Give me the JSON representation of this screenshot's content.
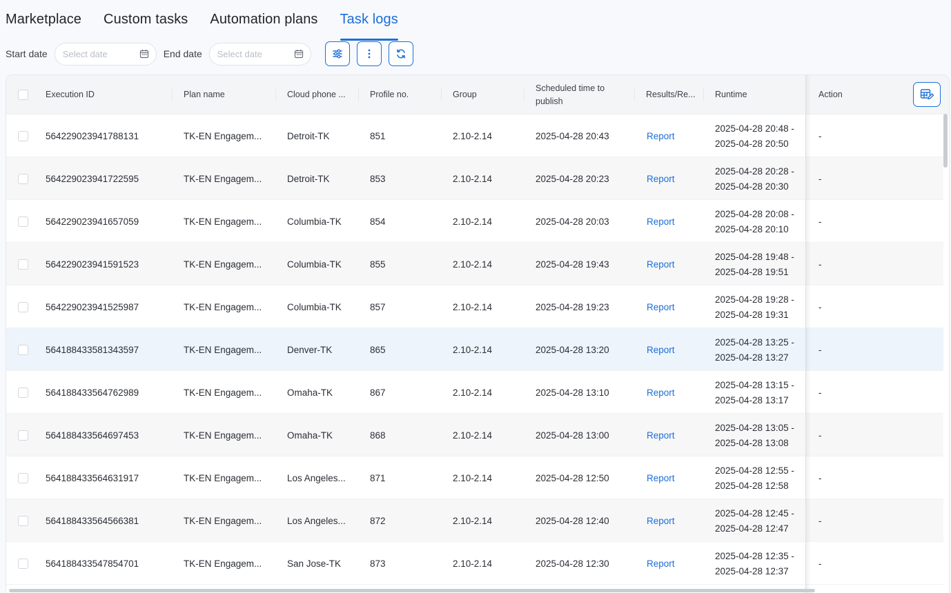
{
  "tabs": [
    {
      "label": "Marketplace",
      "active": false
    },
    {
      "label": "Custom tasks",
      "active": false
    },
    {
      "label": "Automation plans",
      "active": false
    },
    {
      "label": "Task logs",
      "active": true
    }
  ],
  "filters": {
    "start_label": "Start date",
    "start_placeholder": "Select date",
    "end_label": "End date",
    "end_placeholder": "Select date"
  },
  "columns": {
    "execution_id": "Execution ID",
    "plan_name": "Plan name",
    "cloud_phone": "Cloud phone ...",
    "profile_no": "Profile no.",
    "group": "Group",
    "scheduled": "Scheduled time to publish",
    "results": "Results/Re...",
    "runtime": "Runtime",
    "action": "Action"
  },
  "rows": [
    {
      "id": "564229023941788131",
      "plan": "TK-EN Engagem...",
      "phone": "Detroit-TK",
      "profile": "851",
      "group": "2.10-2.14",
      "scheduled": "2025-04-28 20:43",
      "result": "Report",
      "runtime_start": "2025-04-28 20:48 -",
      "runtime_end": "2025-04-28 20:50",
      "action": "-"
    },
    {
      "id": "564229023941722595",
      "plan": "TK-EN Engagem...",
      "phone": "Detroit-TK",
      "profile": "853",
      "group": "2.10-2.14",
      "scheduled": "2025-04-28 20:23",
      "result": "Report",
      "runtime_start": "2025-04-28 20:28 -",
      "runtime_end": "2025-04-28 20:30",
      "action": "-"
    },
    {
      "id": "564229023941657059",
      "plan": "TK-EN Engagem...",
      "phone": "Columbia-TK",
      "profile": "854",
      "group": "2.10-2.14",
      "scheduled": "2025-04-28 20:03",
      "result": "Report",
      "runtime_start": "2025-04-28 20:08 -",
      "runtime_end": "2025-04-28 20:10",
      "action": "-"
    },
    {
      "id": "564229023941591523",
      "plan": "TK-EN Engagem...",
      "phone": "Columbia-TK",
      "profile": "855",
      "group": "2.10-2.14",
      "scheduled": "2025-04-28 19:43",
      "result": "Report",
      "runtime_start": "2025-04-28 19:48 -",
      "runtime_end": "2025-04-28 19:51",
      "action": "-"
    },
    {
      "id": "564229023941525987",
      "plan": "TK-EN Engagem...",
      "phone": "Columbia-TK",
      "profile": "857",
      "group": "2.10-2.14",
      "scheduled": "2025-04-28 19:23",
      "result": "Report",
      "runtime_start": "2025-04-28 19:28 -",
      "runtime_end": "2025-04-28 19:31",
      "action": "-"
    },
    {
      "id": "564188433581343597",
      "plan": "TK-EN Engagem...",
      "phone": "Denver-TK",
      "profile": "865",
      "group": "2.10-2.14",
      "scheduled": "2025-04-28 13:20",
      "result": "Report",
      "runtime_start": "2025-04-28 13:25 -",
      "runtime_end": "2025-04-28 13:27",
      "action": "-"
    },
    {
      "id": "564188433564762989",
      "plan": "TK-EN Engagem...",
      "phone": "Omaha-TK",
      "profile": "867",
      "group": "2.10-2.14",
      "scheduled": "2025-04-28 13:10",
      "result": "Report",
      "runtime_start": "2025-04-28 13:15 -",
      "runtime_end": "2025-04-28 13:17",
      "action": "-"
    },
    {
      "id": "564188433564697453",
      "plan": "TK-EN Engagem...",
      "phone": "Omaha-TK",
      "profile": "868",
      "group": "2.10-2.14",
      "scheduled": "2025-04-28 13:00",
      "result": "Report",
      "runtime_start": "2025-04-28 13:05 -",
      "runtime_end": "2025-04-28 13:08",
      "action": "-"
    },
    {
      "id": "564188433564631917",
      "plan": "TK-EN Engagem...",
      "phone": "Los Angeles...",
      "profile": "871",
      "group": "2.10-2.14",
      "scheduled": "2025-04-28 12:50",
      "result": "Report",
      "runtime_start": "2025-04-28 12:55 -",
      "runtime_end": "2025-04-28 12:58",
      "action": "-"
    },
    {
      "id": "564188433564566381",
      "plan": "TK-EN Engagem...",
      "phone": "Los Angeles...",
      "profile": "872",
      "group": "2.10-2.14",
      "scheduled": "2025-04-28 12:40",
      "result": "Report",
      "runtime_start": "2025-04-28 12:45 -",
      "runtime_end": "2025-04-28 12:47",
      "action": "-"
    },
    {
      "id": "564188433547854701",
      "plan": "TK-EN Engagem...",
      "phone": "San Jose-TK",
      "profile": "873",
      "group": "2.10-2.14",
      "scheduled": "2025-04-28 12:30",
      "result": "Report",
      "runtime_start": "2025-04-28 12:35 -",
      "runtime_end": "2025-04-28 12:37",
      "action": "-"
    }
  ],
  "highlighted_row_index": 5,
  "colors": {
    "accent": "#1a6ed8",
    "row_alt": "#f7f7f8",
    "row_highlight": "#edf4fc"
  },
  "icons": {
    "calendar": "calendar-icon",
    "filter": "sliders-icon",
    "more": "more-vertical-icon",
    "refresh": "refresh-icon",
    "columns": "table-settings-icon"
  }
}
